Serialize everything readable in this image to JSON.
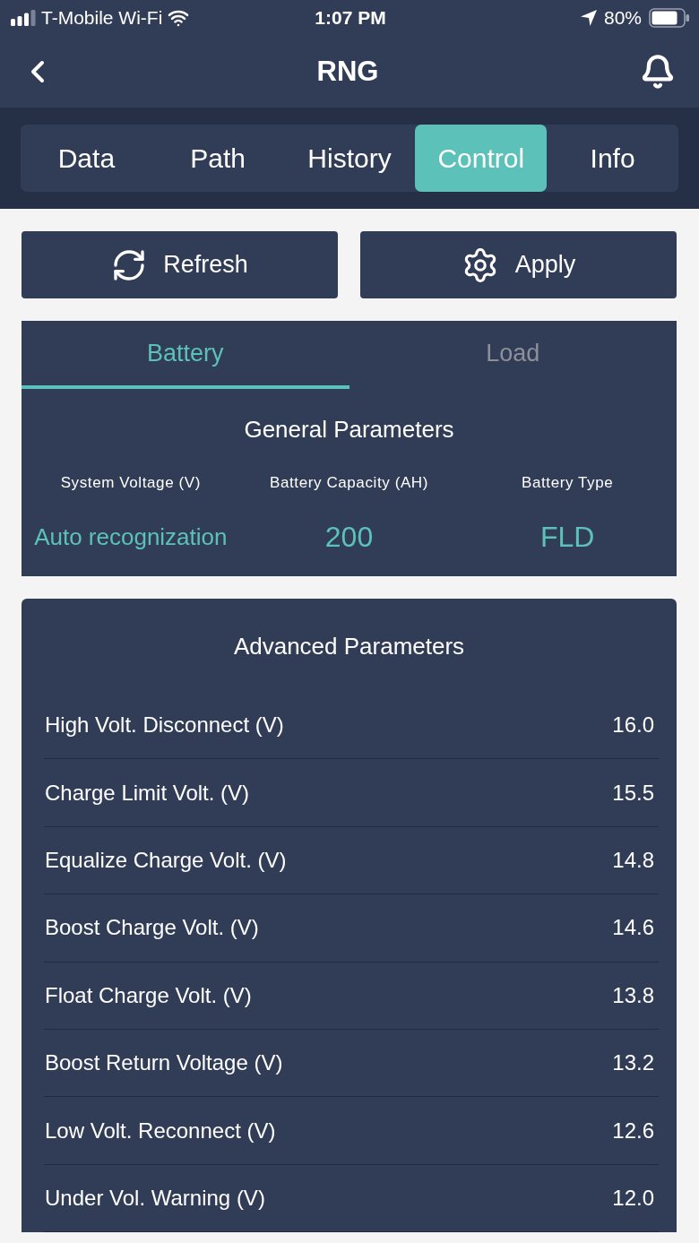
{
  "status_bar": {
    "carrier": "T-Mobile Wi-Fi",
    "time": "1:07 PM",
    "battery": "80%"
  },
  "nav": {
    "title": "RNG"
  },
  "tabs": [
    {
      "label": "Data",
      "selected": false
    },
    {
      "label": "Path",
      "selected": false
    },
    {
      "label": "History",
      "selected": false
    },
    {
      "label": "Control",
      "selected": true
    },
    {
      "label": "Info",
      "selected": false
    }
  ],
  "actions": [
    {
      "kind": "refresh",
      "label": "Refresh"
    },
    {
      "kind": "apply",
      "label": "Apply"
    }
  ],
  "settings_tabs": [
    {
      "label": "Battery",
      "selected": true
    },
    {
      "label": "Load",
      "selected": false
    }
  ],
  "general_parameters": {
    "title": "General Parameters",
    "fields": [
      {
        "label": "System Voltage (V)",
        "value": "Auto recognization"
      },
      {
        "label": "Battery Capacity (AH)",
        "value": "200"
      },
      {
        "label": "Battery Type",
        "value": "FLD"
      }
    ]
  },
  "advanced_parameters": {
    "title": "Advanced Parameters",
    "rows": [
      {
        "label": "High Volt. Disconnect (V)",
        "value": "16.0"
      },
      {
        "label": "Charge Limit Volt. (V)",
        "value": "15.5"
      },
      {
        "label": "Equalize Charge Volt. (V)",
        "value": "14.8"
      },
      {
        "label": "Boost Charge Volt. (V)",
        "value": "14.6"
      },
      {
        "label": "Float Charge Volt. (V)",
        "value": "13.8"
      },
      {
        "label": "Boost Return Voltage (V)",
        "value": "13.2"
      },
      {
        "label": "Low Volt. Reconnect (V)",
        "value": "12.6"
      },
      {
        "label": "Under Vol. Warning (V)",
        "value": "12.0"
      }
    ]
  }
}
